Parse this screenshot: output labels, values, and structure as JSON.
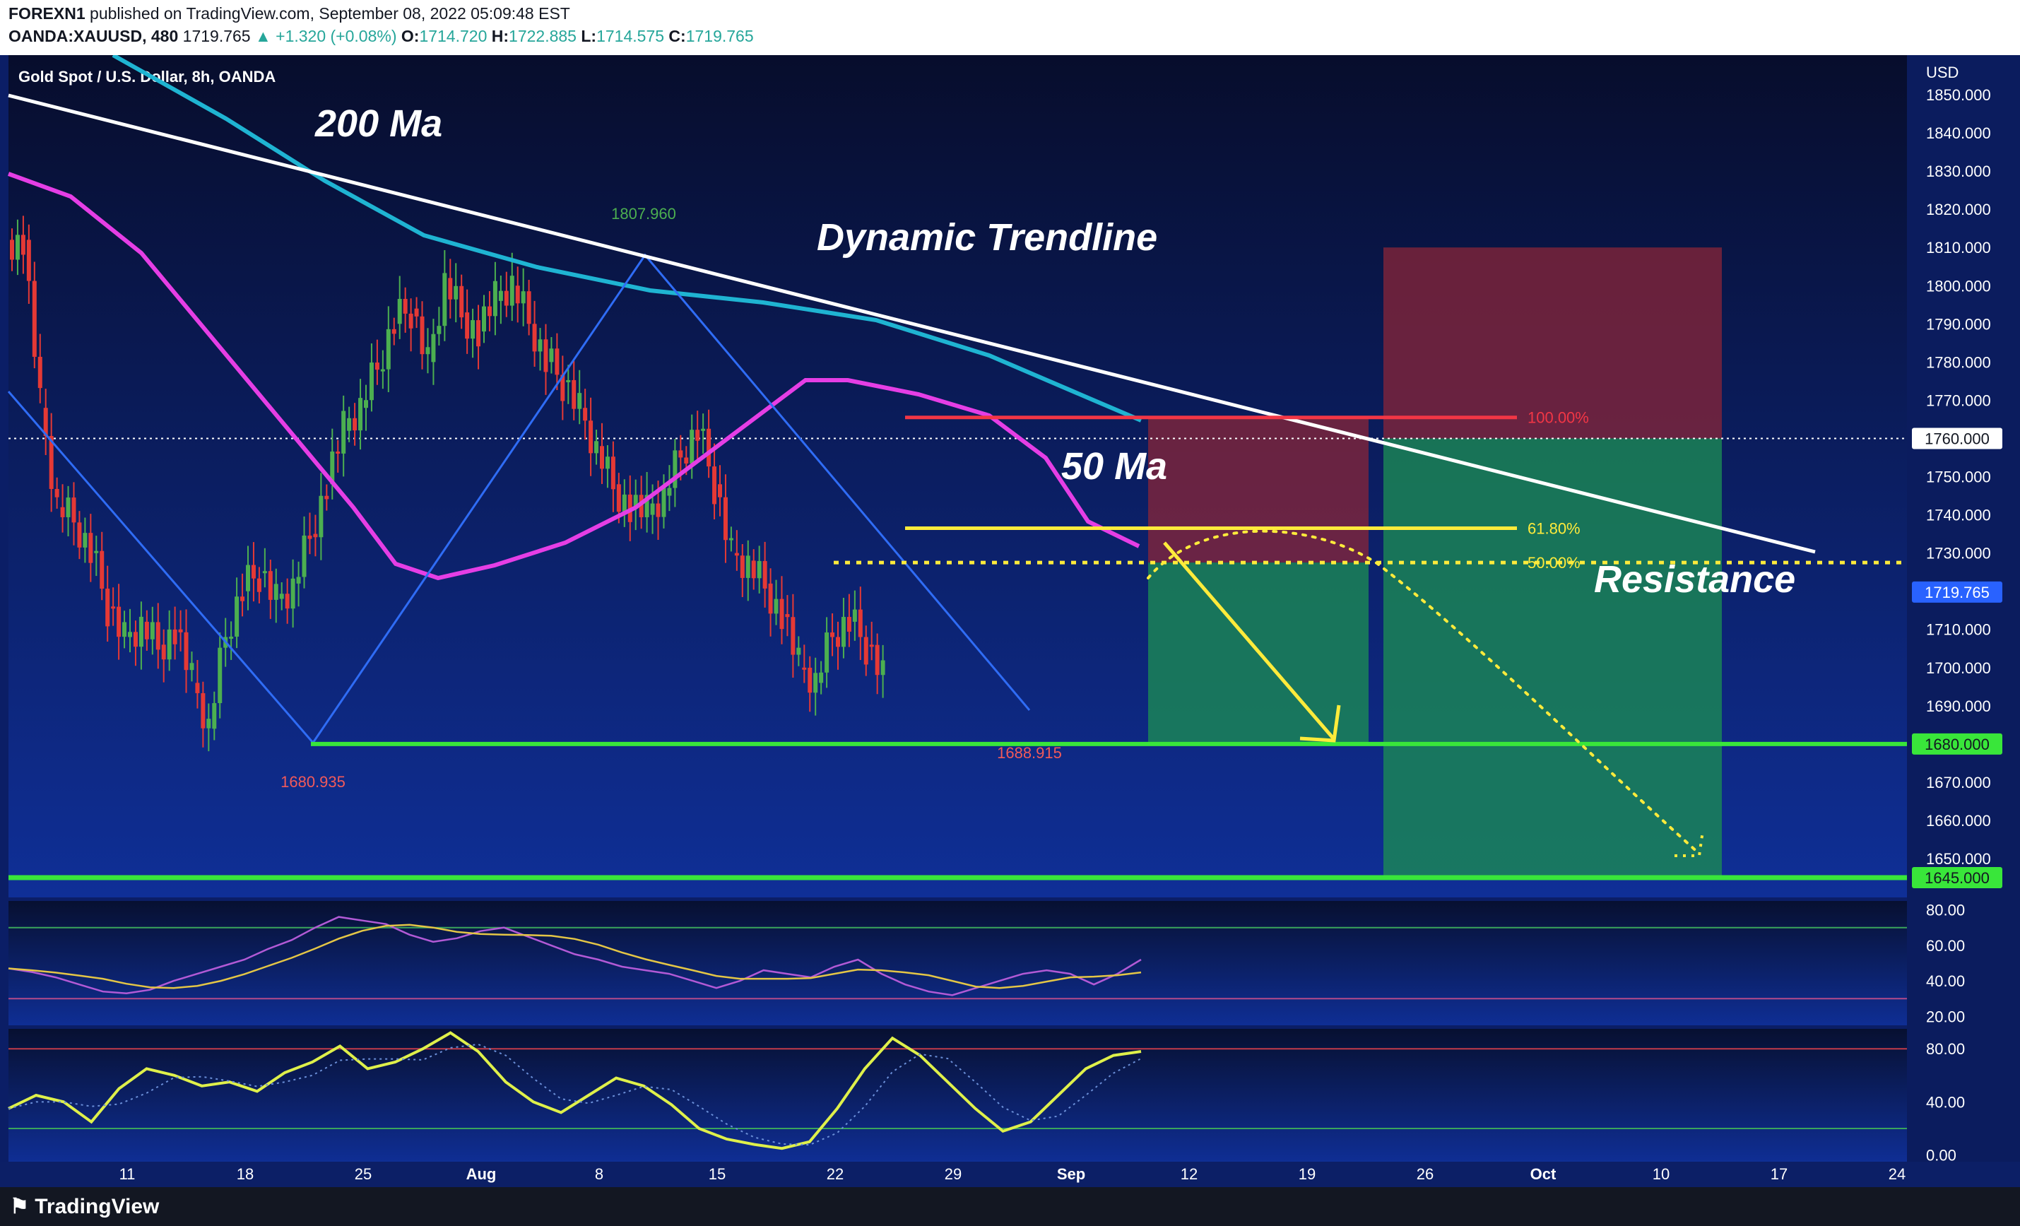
{
  "header": {
    "author": "FOREXN1",
    "published_text": "published on TradingView.com, September 08, 2022 05:09:48 EST",
    "symbol": "OANDA:XAUUSD, 480",
    "last": "1719.765",
    "change": "+1.320 (+0.08%)",
    "o_label": "O:",
    "o_value": "1714.720",
    "h_label": "H:",
    "h_value": "1722.885",
    "l_label": "L:",
    "l_value": "1714.575",
    "c_label": "C:",
    "c_value": "1719.765"
  },
  "footer": {
    "brand": "TradingView"
  },
  "colors": {
    "background_top": "#070d2c",
    "background_bottom": "#0f2f97",
    "up_candle": "#4caf50",
    "down_candle": "#e53935",
    "ma200": "#1fb4d2",
    "ma50": "#e53ee5",
    "trendline": "#ffffff",
    "fib": "#ffeb3b",
    "fib_100": "#f23645",
    "support": "#39e63a",
    "stop_zone": "#8a2538",
    "target_zone": "#1b8a55",
    "rsi": "#b25ad6",
    "rsi_ma": "#e4c646",
    "stoch": "#dff04a"
  },
  "chart_data": {
    "type": "candlestick",
    "title": "Gold Spot / U.S. Dollar, 8h, OANDA",
    "currency": "USD",
    "ylim": [
      1645,
      1855
    ],
    "y_ticks": [
      "1650.000",
      "1660.000",
      "1670.000",
      "1680.000",
      "1690.000",
      "1700.000",
      "1710.000",
      "1720.000",
      "1730.000",
      "1740.000",
      "1750.000",
      "1760.000",
      "1770.000",
      "1780.000",
      "1790.000",
      "1800.000",
      "1810.000",
      "1820.000",
      "1830.000",
      "1840.000",
      "1850.000"
    ],
    "x_ticks": [
      "11",
      "18",
      "25",
      "Aug",
      "8",
      "15",
      "22",
      "29",
      "Sep",
      "12",
      "19",
      "26",
      "Oct",
      "10",
      "17",
      "24"
    ],
    "close_series_days": [
      0,
      1,
      2,
      3,
      4,
      5,
      6,
      7,
      8,
      9,
      10,
      11,
      12,
      13,
      14,
      15,
      16,
      17,
      18,
      19,
      20,
      21,
      22,
      23,
      24,
      25,
      26,
      27,
      28,
      29,
      30,
      31,
      32,
      33,
      34,
      35,
      36,
      37,
      38,
      39,
      40,
      41,
      42,
      43,
      44,
      45,
      46,
      47,
      48,
      49,
      50,
      51,
      52,
      53,
      54,
      55,
      56,
      57,
      58,
      59,
      60,
      61,
      62,
      63,
      64,
      65,
      66
    ],
    "close_series": [
      1812,
      1768,
      1742,
      1738,
      1730,
      1716,
      1708,
      1712,
      1706,
      1710,
      1696,
      1684,
      1708,
      1720,
      1725,
      1718,
      1722,
      1735,
      1748,
      1762,
      1768,
      1778,
      1790,
      1794,
      1780,
      1802,
      1793,
      1788,
      1796,
      1800,
      1790,
      1780,
      1775,
      1768,
      1758,
      1748,
      1742,
      1740,
      1745,
      1755,
      1762,
      1748,
      1730,
      1728,
      1722,
      1714,
      1700,
      1696,
      1708,
      1712,
      1706,
      1698,
      1719,
      1719,
      1719,
      1719,
      1719,
      1719,
      1719,
      1719,
      1719,
      1719,
      1719,
      1719,
      1719,
      1719,
      1719
    ],
    "last_price": "1719.765",
    "price_labels": [
      "1760.000",
      "1719.765",
      "1680.000",
      "1645.000"
    ],
    "swing_labels": [
      {
        "text": "1807.960",
        "price": 1807.96,
        "day": 22
      },
      {
        "text": "1680.935",
        "price": 1680.935,
        "day": 11
      },
      {
        "text": "1688.915",
        "price": 1688.915,
        "day": 42
      }
    ],
    "fib_levels": [
      {
        "label": "100.00%",
        "price": 1765.5
      },
      {
        "label": "61.80%",
        "price": 1736.5
      },
      {
        "label": "50.00%",
        "price": 1727.5
      }
    ],
    "annotations": {
      "ma200": "200 Ma",
      "ma50": "50 Ma",
      "trendline": "Dynamic Trendline",
      "resistance": "Resistance"
    },
    "rsi": {
      "ticks": [
        "80.00",
        "60.00",
        "40.00",
        "20.00"
      ],
      "ylim": [
        15,
        85
      ],
      "bands": [
        70,
        30
      ],
      "values": [
        47,
        45,
        42,
        38,
        34,
        33,
        35,
        40,
        44,
        48,
        52,
        58,
        63,
        70,
        76,
        74,
        72,
        66,
        62,
        64,
        68,
        70,
        65,
        60,
        55,
        52,
        48,
        46,
        44,
        40,
        36,
        40,
        46,
        44,
        42,
        48,
        52,
        44,
        38,
        34,
        32,
        36,
        40,
        44,
        46,
        44,
        38,
        44,
        52
      ]
    },
    "stoch": {
      "ticks": [
        "80.00",
        "40.00",
        "0.00"
      ],
      "ylim": [
        -5,
        95
      ],
      "bands": [
        80,
        20
      ],
      "values": [
        35,
        45,
        40,
        25,
        50,
        65,
        60,
        52,
        55,
        48,
        62,
        70,
        82,
        65,
        70,
        80,
        92,
        78,
        55,
        40,
        32,
        45,
        58,
        52,
        38,
        20,
        12,
        8,
        5,
        10,
        35,
        65,
        88,
        75,
        55,
        35,
        18,
        25,
        45,
        65,
        75,
        78
      ]
    },
    "grid": false
  }
}
